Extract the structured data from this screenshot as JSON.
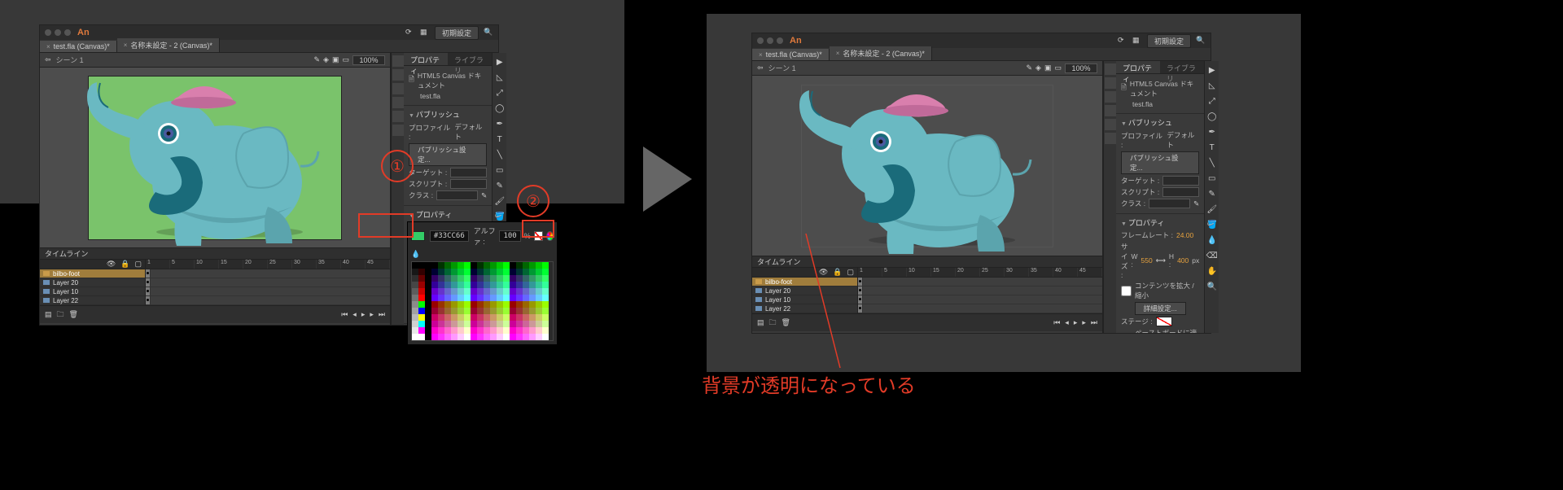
{
  "app": {
    "short_title": "An",
    "preset_btn": "初期設定"
  },
  "tabs": [
    {
      "name": "test.fla (Canvas)*"
    },
    {
      "name": "名称未設定 - 2 (Canvas)*"
    }
  ],
  "scene": {
    "label": "シーン 1",
    "zoom": "100%"
  },
  "panels": {
    "properties_tab": "プロパティ",
    "library_tab": "ライブラリ",
    "doc_type": "HTML5 Canvas ドキュメント",
    "doc_name": "test.fla",
    "publish_hdr": "パブリッシュ",
    "profile_lbl": "プロファイル :",
    "profile_val": "デフォルト",
    "publish_btn": "パブリッシュ設定...",
    "target_lbl": "ターゲット :",
    "script_lbl": "スクリプト :",
    "class_lbl": "クラス :",
    "props_hdr": "プロパティ",
    "fps_lbl": "フレームレート :",
    "fps_val": "24.00",
    "size_lbl": "サイズ :",
    "w_lbl": "W :",
    "w_val": "550",
    "h_lbl": "H :",
    "h_val": "400",
    "px": "px",
    "content_scale": "コンテンツを拡大 / 縮小",
    "adv_btn": "詳細設定...",
    "stage_lbl": "ステージ :",
    "pasteboard_chk": "ペーストボードに適用"
  },
  "colorpicker": {
    "hex": "#33CC66",
    "alpha_lbl": "アルファ :",
    "alpha_val": "100",
    "pct": "%"
  },
  "timeline": {
    "title": "タイムライン",
    "ruler": [
      "1",
      "5",
      "10",
      "15",
      "20",
      "25",
      "30",
      "35",
      "40",
      "45"
    ],
    "layers": [
      {
        "name": "bilbo-foot",
        "type": "folder",
        "selected": true
      },
      {
        "name": "Layer 20",
        "type": "layer"
      },
      {
        "name": "Layer 10",
        "type": "layer"
      },
      {
        "name": "Layer 22",
        "type": "layer"
      }
    ]
  },
  "annotations": {
    "marker1": "①",
    "marker2": "②",
    "caption": "背景が透明になっている"
  }
}
